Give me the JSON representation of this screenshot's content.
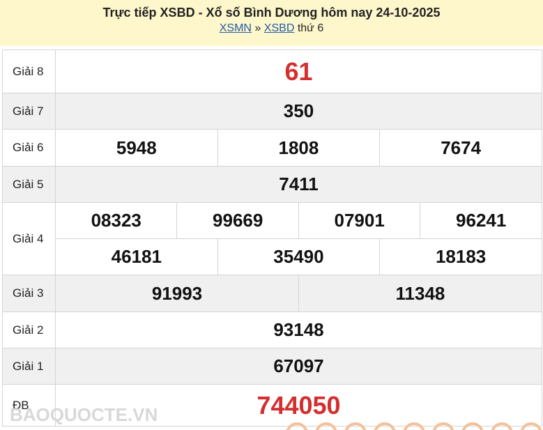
{
  "header": {
    "title": "Trực tiếp XSBD - Xổ số Bình Dương hôm nay 24-10-2025",
    "link_xsmn": "XSMN",
    "separator": "»",
    "link_xsbd": "XSBD",
    "weekday": "thứ 6"
  },
  "prizes": {
    "g8": {
      "label": "Giải 8",
      "numbers": [
        "61"
      ]
    },
    "g7": {
      "label": "Giải 7",
      "numbers": [
        "350"
      ]
    },
    "g6": {
      "label": "Giải 6",
      "numbers": [
        "5948",
        "1808",
        "7674"
      ]
    },
    "g5": {
      "label": "Giải 5",
      "numbers": [
        "7411"
      ]
    },
    "g4": {
      "label": "Giải 4",
      "numbers": [
        "08323",
        "99669",
        "07901",
        "96241",
        "46181",
        "35490",
        "18183"
      ]
    },
    "g3": {
      "label": "Giải 3",
      "numbers": [
        "91993",
        "11348"
      ]
    },
    "g2": {
      "label": "Giải 2",
      "numbers": [
        "93148"
      ]
    },
    "g1": {
      "label": "Giải 1",
      "numbers": [
        "67097"
      ]
    },
    "db": {
      "label": "ĐB",
      "numbers": [
        "744050"
      ]
    }
  },
  "watermark": "BAOQUOCTE.VN",
  "colors": {
    "header_bg": "#fff7cc",
    "highlight": "#d32f2f",
    "row_alt": "#f0f0f0",
    "link": "#1f5aa6"
  }
}
